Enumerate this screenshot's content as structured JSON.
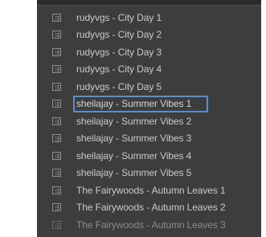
{
  "collections": [
    {
      "label": "rudyvgs - City Day 1",
      "selected": false
    },
    {
      "label": "rudyvgs - City Day 2",
      "selected": false
    },
    {
      "label": "rudyvgs - City Day 3",
      "selected": false
    },
    {
      "label": "rudyvgs - City Day 4",
      "selected": false
    },
    {
      "label": "rudyvgs - City Day 5",
      "selected": false
    },
    {
      "label": "sheilajay - Summer Vibes 1",
      "selected": true
    },
    {
      "label": "sheilajay - Summer Vibes 2",
      "selected": false
    },
    {
      "label": "sheilajay - Summer Vibes 3",
      "selected": false
    },
    {
      "label": "sheilajay - Summer Vibes 4",
      "selected": false
    },
    {
      "label": "sheilajay - Summer Vibes 5",
      "selected": false
    },
    {
      "label": "The Fairywoods - Autumn Leaves 1",
      "selected": false
    },
    {
      "label": "The Fairywoods - Autumn Leaves 2",
      "selected": false
    },
    {
      "label": "The Fairywoods - Autumn Leaves 3",
      "selected": false
    }
  ],
  "icon": "collection-icon",
  "colors": {
    "panel_bg": "#3d3d3d",
    "text": "#c9c9c9",
    "selection_border": "#5b8fc9"
  }
}
